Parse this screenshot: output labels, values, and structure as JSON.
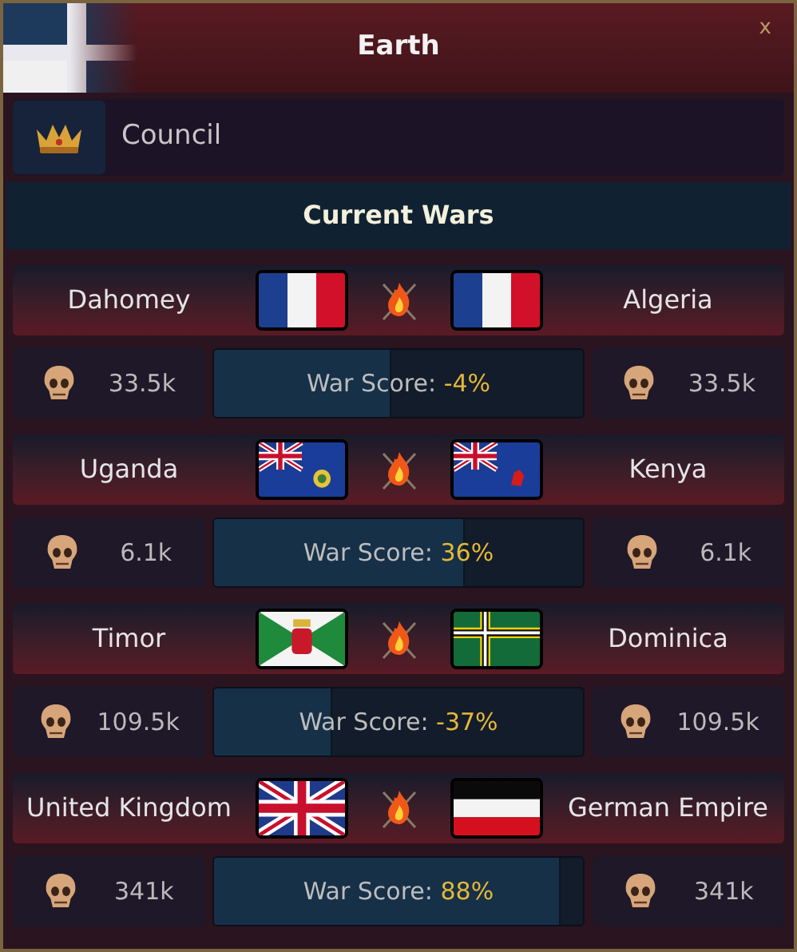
{
  "window": {
    "title": "Earth",
    "close": "x"
  },
  "council": {
    "label": "Council"
  },
  "section_title": "Current Wars",
  "wars": [
    {
      "left": {
        "name": "Dahomey",
        "flag": {
          "kind": "france"
        },
        "casualties": "33.5k"
      },
      "right": {
        "name": "Algeria",
        "flag": {
          "kind": "france"
        },
        "casualties": "33.5k"
      },
      "score_label": "War Score:",
      "score": "-4%",
      "level": 0.48
    },
    {
      "left": {
        "name": "Uganda",
        "flag": {
          "kind": "ensign-badge"
        },
        "casualties": "6.1k"
      },
      "right": {
        "name": "Kenya",
        "flag": {
          "kind": "ensign-lion"
        },
        "casualties": "6.1k"
      },
      "score_label": "War Score:",
      "score": "36%",
      "level": 0.68
    },
    {
      "left": {
        "name": "Timor",
        "flag": {
          "kind": "timor"
        },
        "casualties": "109.5k"
      },
      "right": {
        "name": "Dominica",
        "flag": {
          "kind": "dominica"
        },
        "casualties": "109.5k"
      },
      "score_label": "War Score:",
      "score": "-37%",
      "level": 0.32
    },
    {
      "left": {
        "name": "United Kingdom",
        "flag": {
          "kind": "union"
        },
        "casualties": "341k"
      },
      "right": {
        "name": "German Empire",
        "flag": {
          "kind": "tricolor-bwr"
        },
        "casualties": "341k"
      },
      "score_label": "War Score:",
      "score": "88%",
      "level": 0.94
    }
  ]
}
